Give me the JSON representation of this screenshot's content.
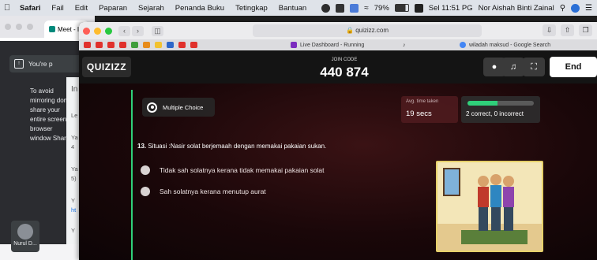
{
  "menubar": {
    "app": "Safari",
    "items": [
      "Fail",
      "Edit",
      "Paparan",
      "Sejarah",
      "Penanda Buku",
      "Tetingkap",
      "Bantuan"
    ],
    "battery": "79%",
    "clock": "Sel 11:51 PG",
    "user": "Nor Aishah Binti Zainal"
  },
  "bg_window": {
    "tab_label": "Meet - I",
    "address": "me",
    "share_label": "You're p",
    "avoid_text": "To avoid mirroring don't share your entire screen or browser window Share j",
    "side_letters": [
      "In",
      "Le",
      "Ya",
      "4",
      "Ya",
      "5)",
      "Y",
      "ht",
      "Y"
    ],
    "participant_name": "Nurul D..."
  },
  "safari": {
    "address": "quizizz.com",
    "tabs": [
      "Live Dashboard - Running",
      "wiladah maksud - Google Search"
    ]
  },
  "quizizz": {
    "logo": "QUIZIZZ",
    "join_label": "JOIN CODE",
    "join_code": "440 874",
    "end_label": "End",
    "question_type": "Multiple Choice",
    "avg_label": "Avg. time taken",
    "avg_value": "19 secs",
    "results_text": "2 correct, 0 incorrect",
    "correct_fraction": 0.45,
    "question_number": "13.",
    "question_text": "Situasi :Nasir solat berjemaah dengan memakai pakaian sukan.",
    "options": [
      "Tidak sah solatnya kerana tidak memakai pakaian solat",
      "Sah solatnya kerana menutup aurat"
    ]
  }
}
